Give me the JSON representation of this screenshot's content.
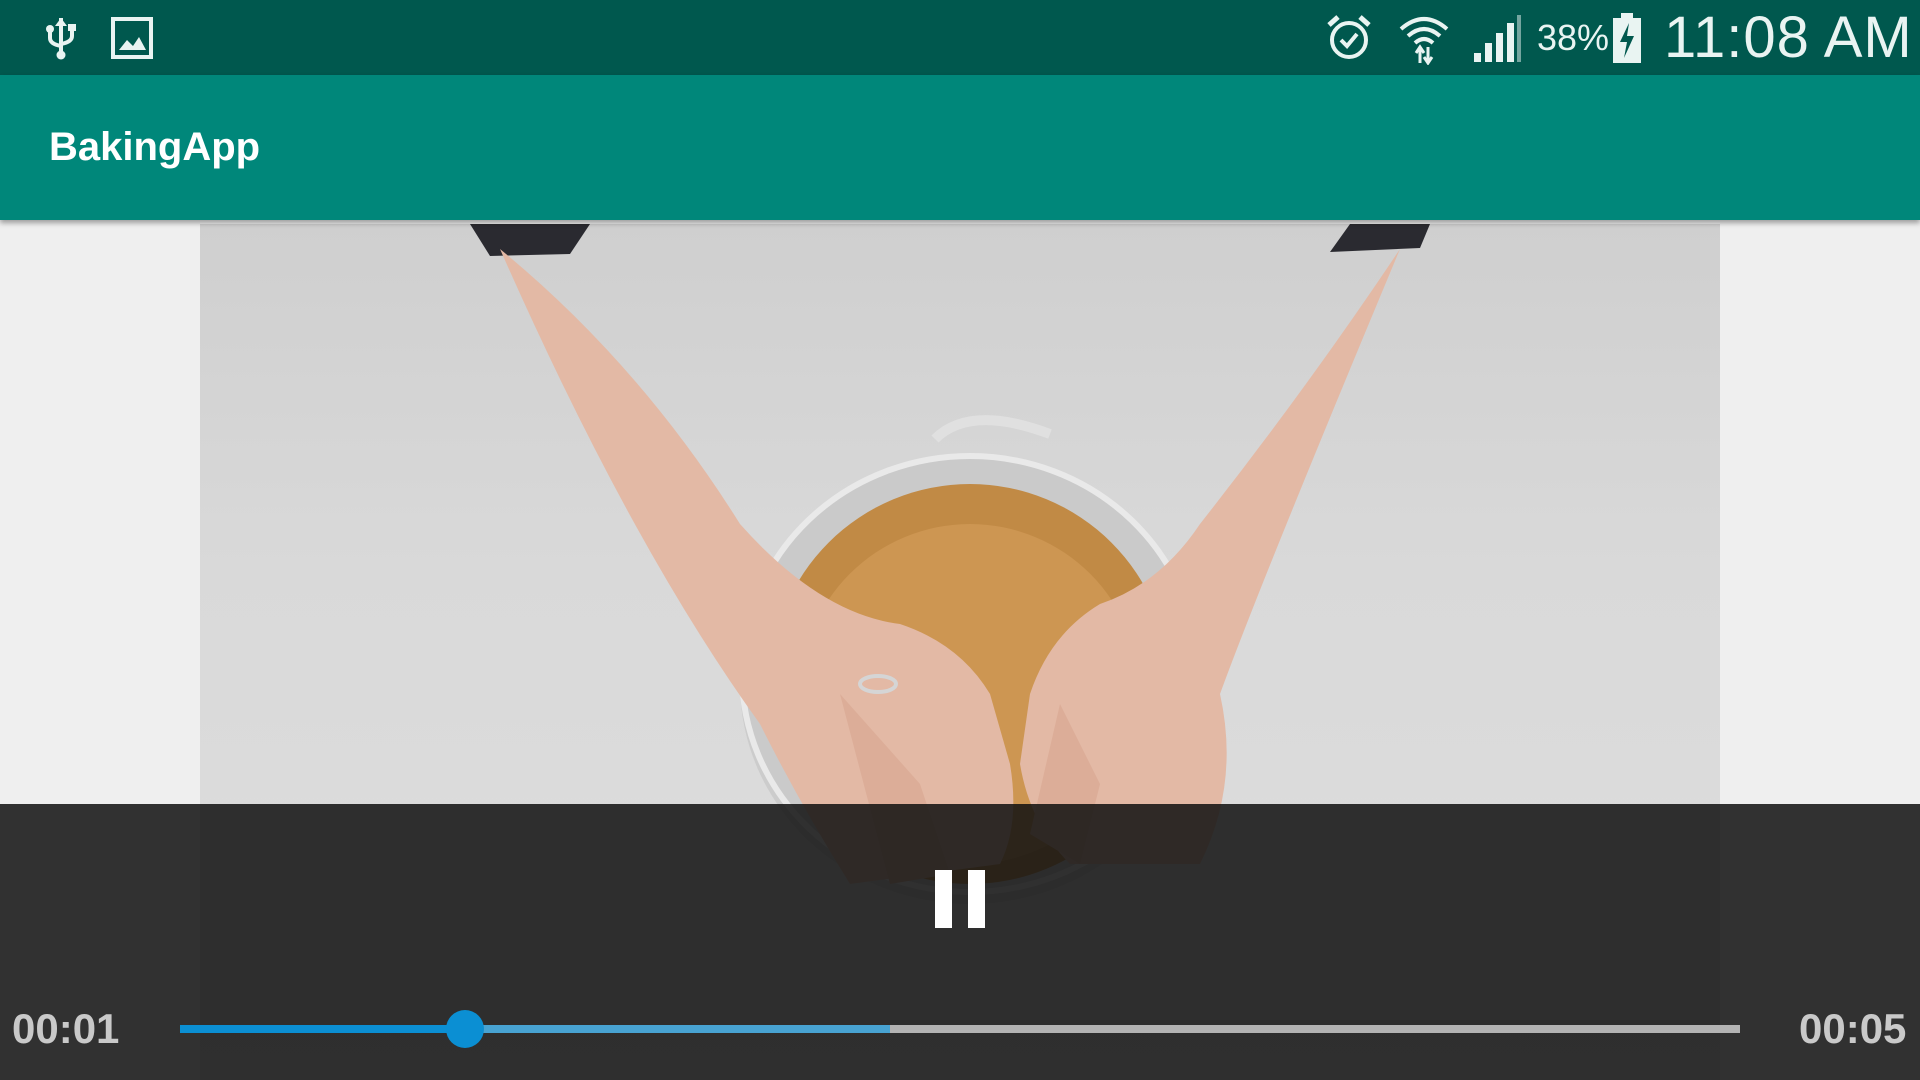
{
  "status_bar": {
    "icons": [
      "usb-icon",
      "gallery-icon",
      "alarm-icon",
      "wifi-icon",
      "signal-icon",
      "battery-charging-icon"
    ],
    "battery_percent": "38%",
    "time": "11:08 AM"
  },
  "app_bar": {
    "title": "BakingApp"
  },
  "player": {
    "current_time": "00:01",
    "duration": "00:05",
    "played_fraction": 0.183,
    "buffered_fraction": 0.455,
    "state_control": "pause-icon"
  },
  "colors": {
    "status_bar": "#00584e",
    "app_bar": "#00877a",
    "seek_played": "#0b8fd3",
    "seek_buffered": "#48a3d2",
    "seek_track": "#b3b3b3"
  }
}
